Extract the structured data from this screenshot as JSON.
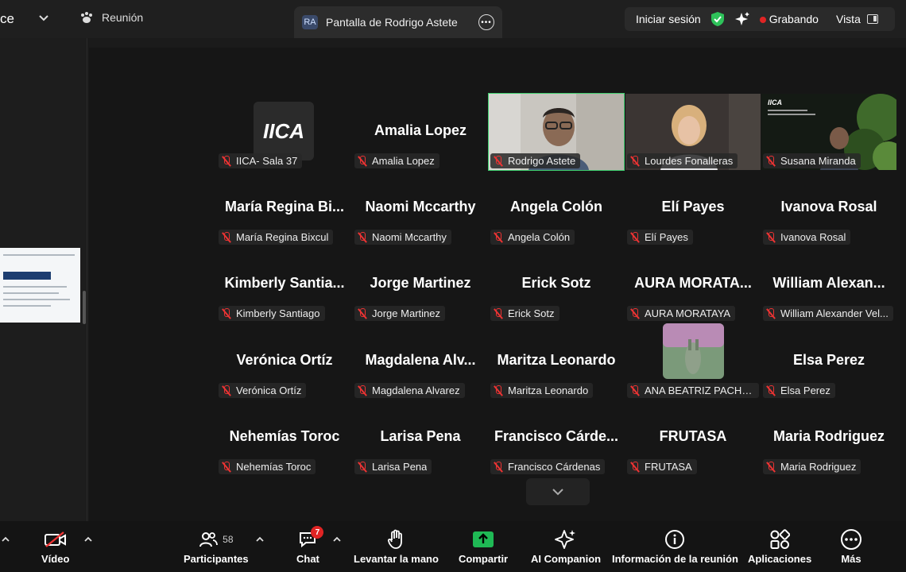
{
  "topbar": {
    "left_text": "ce",
    "meeting_label": "Reunión",
    "share_tab": {
      "badge": "RA",
      "label": "Pantalla de Rodrigo Astete"
    },
    "signin": "Iniciar sesión",
    "recording": "Grabando",
    "view": "Vista"
  },
  "tiles": [
    {
      "big": "",
      "plate": "IICA- Sala 37",
      "kind": "logo",
      "logo_text": "IICA"
    },
    {
      "big": "Amalia Lopez",
      "plate": "Amalia Lopez"
    },
    {
      "big": "",
      "plate": "Rodrigo Astete",
      "kind": "video-man",
      "active": true
    },
    {
      "big": "",
      "plate": "Lourdes Fonalleras",
      "kind": "video-woman"
    },
    {
      "big": "",
      "plate": "Susana Miranda",
      "kind": "video-iica"
    },
    {
      "big": "María Regina Bi...",
      "plate": "María Regina Bixcul"
    },
    {
      "big": "Naomi Mccarthy",
      "plate": "Naomi Mccarthy"
    },
    {
      "big": "Angela Colón",
      "plate": "Angela Colón"
    },
    {
      "big": "Elí Payes",
      "plate": "Elí Payes"
    },
    {
      "big": "Ivanova Rosal",
      "plate": "Ivanova Rosal"
    },
    {
      "big": "Kimberly Santia...",
      "plate": "Kimberly Santiago"
    },
    {
      "big": "Jorge Martinez",
      "plate": "Jorge Martinez"
    },
    {
      "big": "Erick Sotz",
      "plate": "Erick Sotz"
    },
    {
      "big": "AURA MORATA...",
      "plate": "AURA MORATAYA"
    },
    {
      "big": "William Alexan...",
      "plate": "William Alexander Vel..."
    },
    {
      "big": "Verónica Ortíz",
      "plate": "Verónica Ortíz"
    },
    {
      "big": "Magdalena Alv...",
      "plate": "Magdalena Alvarez"
    },
    {
      "big": "Maritza Leonardo",
      "plate": "Maritza Leonardo"
    },
    {
      "big": "",
      "plate": "ANA BEATRIZ PACHEC...",
      "kind": "avatar-pic"
    },
    {
      "big": "Elsa Perez",
      "plate": "Elsa Perez"
    },
    {
      "big": "Nehemías Toroc",
      "plate": "Nehemías Toroc"
    },
    {
      "big": "Larisa Pena",
      "plate": "Larisa Pena"
    },
    {
      "big": "Francisco Cárde...",
      "plate": "Francisco Cárdenas"
    },
    {
      "big": "FRUTASA",
      "plate": "FRUTASA"
    },
    {
      "big": "Maria Rodriguez",
      "plate": "Maria Rodriguez"
    }
  ],
  "toolbar": {
    "video": "Vídeo",
    "participants": "Participantes",
    "participants_count": "58",
    "chat": "Chat",
    "chat_badge": "7",
    "raise_hand": "Levantar la mano",
    "share": "Compartir",
    "ai": "AI Companion",
    "info": "Información de la reunión",
    "apps": "Aplicaciones",
    "more": "Más"
  },
  "colors": {
    "active_border": "#3ecf6e",
    "recording": "#e02424",
    "share_green": "#1fb955",
    "muted": "#e33333"
  }
}
